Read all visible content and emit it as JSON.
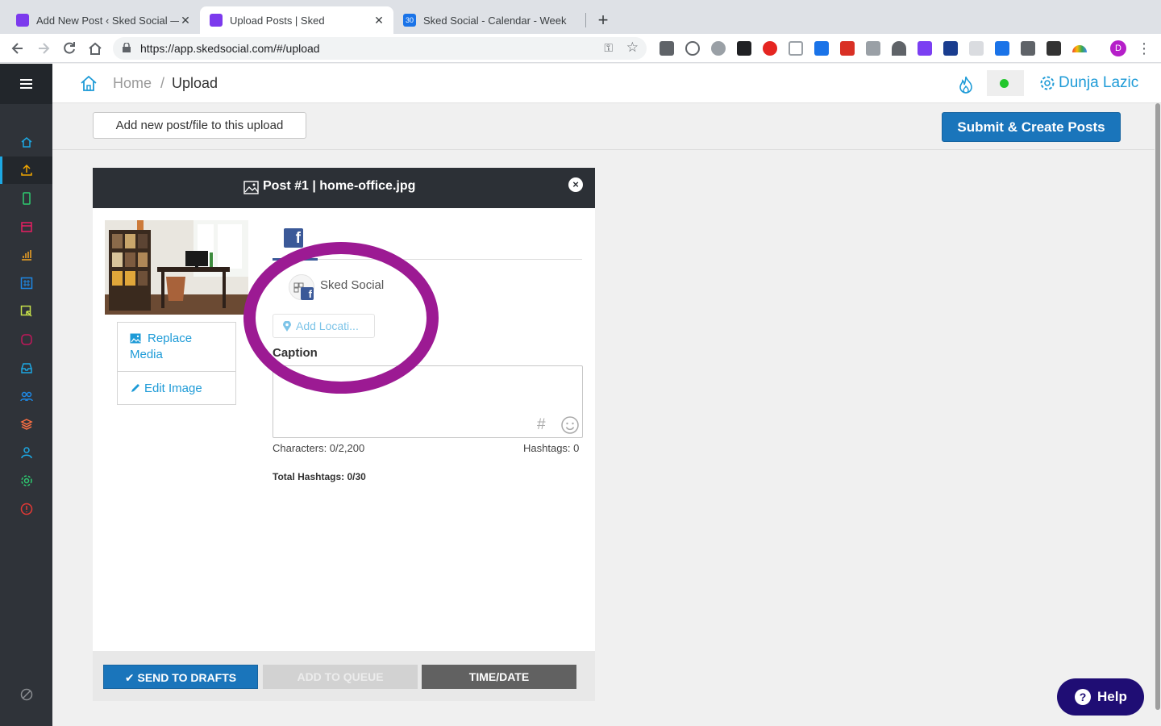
{
  "browser": {
    "tabs": [
      {
        "title": "Add New Post ‹ Sked Social —",
        "favicon_color": "#7c3aed",
        "close": "✕"
      },
      {
        "title": "Upload Posts | Sked",
        "favicon_color": "#7c3aed",
        "close": "✕"
      },
      {
        "title": "Sked Social - Calendar - Week",
        "favicon_color": "#1a73e8",
        "favicon_text": "30"
      }
    ],
    "new_tab": "+",
    "url": "https://app.skedsocial.com/#/upload",
    "profile_initial": "D"
  },
  "header": {
    "breadcrumb_home": "Home",
    "breadcrumb_sep": "/",
    "breadcrumb_current": "Upload",
    "user_name": "Dunja Lazic",
    "status_color": "#22c62c"
  },
  "actions": {
    "add_label": "Add new post/file to this upload",
    "submit_label": "Submit & Create Posts"
  },
  "sidebar": {
    "items": [
      {
        "name": "home",
        "color": "#1da8e3"
      },
      {
        "name": "upload",
        "color": "#f0a500",
        "active": true
      },
      {
        "name": "mobile",
        "color": "#2ecc71"
      },
      {
        "name": "calendar",
        "color": "#e91e63"
      },
      {
        "name": "analytics",
        "color": "#f5a623"
      },
      {
        "name": "hashtag",
        "color": "#1e88e5"
      },
      {
        "name": "link",
        "color": "#c6e04a"
      },
      {
        "name": "stories",
        "color": "#c2185b"
      },
      {
        "name": "inbox",
        "color": "#1da8e3"
      },
      {
        "name": "team",
        "color": "#1e88e5"
      },
      {
        "name": "layers",
        "color": "#ff7043"
      },
      {
        "name": "user",
        "color": "#1da8e3"
      },
      {
        "name": "settings",
        "color": "#2ecc71"
      },
      {
        "name": "help",
        "color": "#e53935"
      }
    ]
  },
  "post": {
    "title": "Post #1 | home-office.jpg",
    "close": "×",
    "replace_media": {
      "line1": "Replace",
      "line2": "Media"
    },
    "edit_image": "Edit Image",
    "facebook_letter": "f",
    "account_name": "Sked Social",
    "location_placeholder": "Add Locati...",
    "caption_label": "Caption",
    "hash_symbol": "#",
    "characters": "Characters: 0/2,200",
    "hashtags": "Hashtags: 0",
    "total_hashtags": "Total Hashtags: 0/30",
    "buttons": {
      "drafts": "✔ SEND TO DRAFTS",
      "queue": "ADD TO QUEUE",
      "time_date": "TIME/DATE"
    }
  },
  "help_label": "Help"
}
